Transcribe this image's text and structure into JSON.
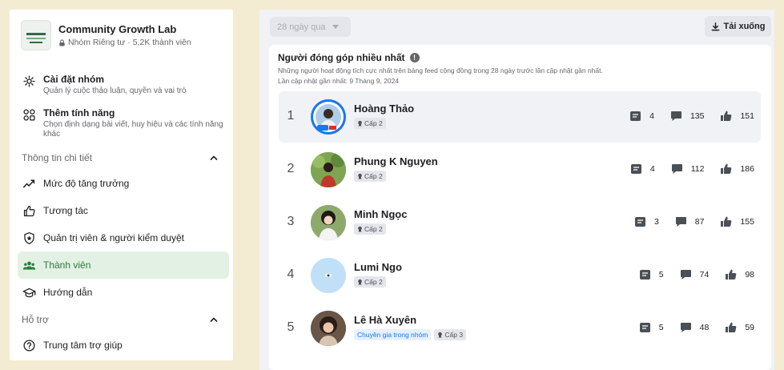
{
  "sidebar": {
    "group_name": "Community Growth Lab",
    "group_privacy": "Nhóm Riêng tư",
    "group_separator": "·",
    "group_members": "5,2K thành viên",
    "settings": {
      "title": "Cài đặt nhóm",
      "subtitle": "Quản lý cuộc thảo luận, quyền và vai trò"
    },
    "features": {
      "title": "Thêm tính năng",
      "subtitle": "Chọn định dạng bài viết, huy hiệu và các tính năng khác"
    },
    "details_header": "Thông tin chi tiết",
    "detail_items": [
      "Mức độ tăng trưởng",
      "Tương tác",
      "Quản trị viên & người kiểm duyệt",
      "Thành viên",
      "Hướng dẫn"
    ],
    "support_header": "Hỗ trợ",
    "support_items": [
      "Trung tâm trợ giúp"
    ]
  },
  "toolbar": {
    "range": "28 ngày qua",
    "download_label": "Tải xuống"
  },
  "card": {
    "title": "Người đóng góp nhiều nhất",
    "description": "Những người hoạt động tích cực nhất trên bảng feed cộng đồng trong 28 ngày trước lần cập nhật gần nhất.",
    "updated": "Lần cập nhật gần nhất: 9 Tháng 9, 2024"
  },
  "contributors": [
    {
      "rank": "1",
      "name": "Hoàng Thảo",
      "badges": [
        {
          "text": "Cấp 2",
          "kind": "level"
        }
      ],
      "posts": "4",
      "comments": "135",
      "reactions": "151"
    },
    {
      "rank": "2",
      "name": "Phung K Nguyen",
      "badges": [
        {
          "text": "Cấp 2",
          "kind": "level"
        }
      ],
      "posts": "4",
      "comments": "112",
      "reactions": "186"
    },
    {
      "rank": "3",
      "name": "Minh Ngọc",
      "badges": [
        {
          "text": "Cấp 2",
          "kind": "level"
        }
      ],
      "posts": "3",
      "comments": "87",
      "reactions": "155"
    },
    {
      "rank": "4",
      "name": "Lumi Ngo",
      "badges": [
        {
          "text": "Cấp 2",
          "kind": "level"
        }
      ],
      "posts": "5",
      "comments": "74",
      "reactions": "98"
    },
    {
      "rank": "5",
      "name": "Lê Hà Xuyên",
      "badges": [
        {
          "text": "Chuyên gia trong nhóm",
          "kind": "expert"
        },
        {
          "text": "Cấp 3",
          "kind": "level"
        }
      ],
      "posts": "5",
      "comments": "48",
      "reactions": "59"
    }
  ],
  "colors": {
    "active_bg": "#e3f1e4",
    "active_text": "#2b7a3c",
    "expert_badge": "#1877f2",
    "page_bg": "#f3ecd2"
  },
  "icons": {
    "settings": "gear-icon",
    "features": "grid-icon",
    "growth": "trend-icon",
    "engagement": "thumbs-up-outline-icon",
    "admins": "shield-icon",
    "members": "people-icon",
    "guides": "graduation-cap-icon",
    "help": "question-circle-icon",
    "posts": "post-icon",
    "comments": "comment-icon",
    "reactions": "like-icon",
    "download": "download-icon"
  }
}
